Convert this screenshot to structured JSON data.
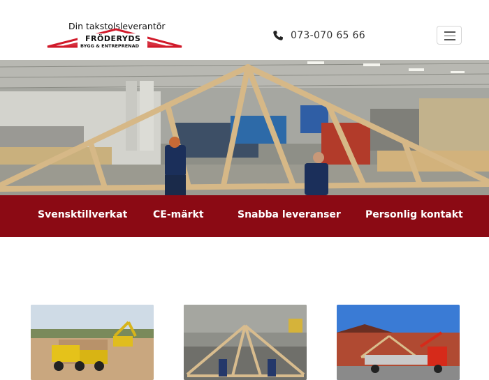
{
  "header": {
    "logo_tagline": "Din takstolsleverantör",
    "logo_name": "FRÖDERYDS",
    "logo_sub": "BYGG & ENTREPRENAD",
    "phone": "073-070 65 66"
  },
  "hero": {
    "image": "truss-factory-workers-photo"
  },
  "features": [
    {
      "label": "Svensktillverkat"
    },
    {
      "label": "CE-märkt"
    },
    {
      "label": "Snabba leveranser"
    },
    {
      "label": "Personlig kontakt"
    }
  ],
  "cards": [
    {
      "image": "excavator-and-dump-truck-photo"
    },
    {
      "image": "truss-lifting-in-factory-photo"
    },
    {
      "image": "truck-delivering-trusses-photo"
    }
  ],
  "colors": {
    "brand_red": "#8b0a14",
    "logo_red": "#d11a2a"
  }
}
